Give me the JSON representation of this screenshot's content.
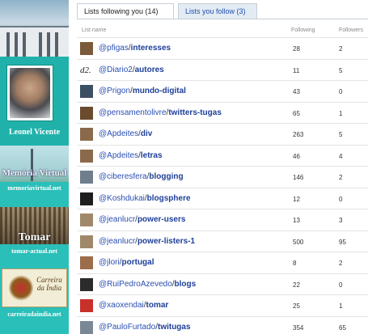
{
  "sidebar": {
    "profile_name": "Leonel Vicente",
    "blogs": [
      {
        "title": "Memória Virtual",
        "url": "memoriavirtual.net"
      },
      {
        "title": "Tomar",
        "url": "tomar-actual.net"
      },
      {
        "title": "Carreira da Índia",
        "url": "carreiradaindia.net"
      }
    ]
  },
  "tabs": [
    {
      "label": "Lists following you (14)",
      "active": true
    },
    {
      "label": "Lists you follow (3)",
      "active": false
    }
  ],
  "columns": {
    "list_name": "List name",
    "following": "Following",
    "followers": "Followers"
  },
  "lists": [
    {
      "owner": "@pfigas",
      "list": "interesses",
      "following": "28",
      "followers": "2",
      "avatar": "#7a5a3a"
    },
    {
      "owner": "@Diario2",
      "list": "autores",
      "following": "11",
      "followers": "5",
      "avatar": "d2-logo"
    },
    {
      "owner": "@Prigon",
      "list": "mundo-digital",
      "following": "43",
      "followers": "0",
      "avatar": "#3d4f63"
    },
    {
      "owner": "@pensamentolivre",
      "list": "twitters-tugas",
      "following": "65",
      "followers": "1",
      "avatar": "#6b4b2e"
    },
    {
      "owner": "@Apdeites",
      "list": "div",
      "following": "263",
      "followers": "5",
      "avatar": "#8a6a4a"
    },
    {
      "owner": "@Apdeites",
      "list": "letras",
      "following": "46",
      "followers": "4",
      "avatar": "#8a6a4a"
    },
    {
      "owner": "@ciberesfera",
      "list": "blogging",
      "following": "146",
      "followers": "2",
      "avatar": "#6f7d8c"
    },
    {
      "owner": "@Koshdukai",
      "list": "blogsphere",
      "following": "12",
      "followers": "0",
      "avatar": "#1e1e1e"
    },
    {
      "owner": "@jeanlucr",
      "list": "power-users",
      "following": "13",
      "followers": "3",
      "avatar": "#a0886a"
    },
    {
      "owner": "@jeanlucr",
      "list": "power-listers-1",
      "following": "500",
      "followers": "95",
      "avatar": "#a0886a"
    },
    {
      "owner": "@jlori",
      "list": "portugal",
      "following": "8",
      "followers": "2",
      "avatar": "#9c6d4a"
    },
    {
      "owner": "@RuiPedroAzevedo",
      "list": "blogs",
      "following": "22",
      "followers": "0",
      "avatar": "#2b2b2b"
    },
    {
      "owner": "@xaoxendai",
      "list": "tomar",
      "following": "25",
      "followers": "1",
      "avatar": "#c8302a"
    },
    {
      "owner": "@PauloFurtado",
      "list": "twitugas",
      "following": "354",
      "followers": "65",
      "avatar": "#7a8896"
    }
  ]
}
